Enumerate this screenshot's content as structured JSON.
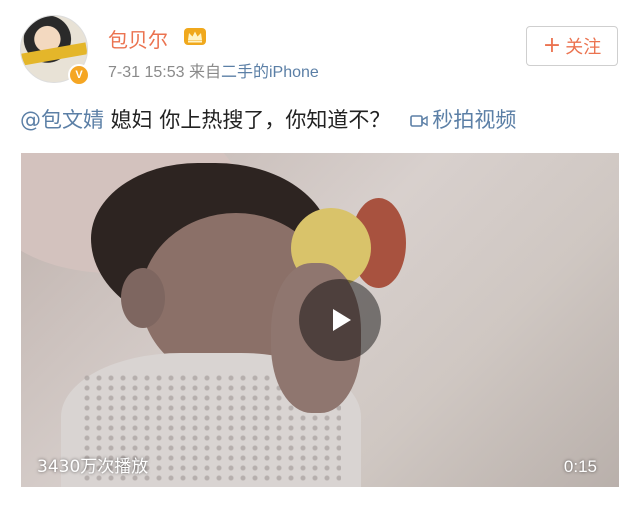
{
  "post": {
    "author": {
      "name": "包贝尔",
      "verified_badge": "V",
      "crown_icon": "crown-icon"
    },
    "meta": {
      "date": "7-31",
      "time": "15:53",
      "from_prefix": "来自",
      "source": "二手的iPhone"
    },
    "follow_button": {
      "label": "关注",
      "plus": "+"
    },
    "text": {
      "mention": "@包文婧",
      "body": " 媳妇 你上热搜了，你知道不？",
      "video_link": "秒拍视频"
    },
    "video": {
      "play_count": "3430万次播放",
      "duration": "0:15"
    }
  },
  "colors": {
    "accent": "#eb7350",
    "link": "#5b7fa6",
    "meta_text": "#8a8a8a",
    "badge": "#f5a623"
  }
}
